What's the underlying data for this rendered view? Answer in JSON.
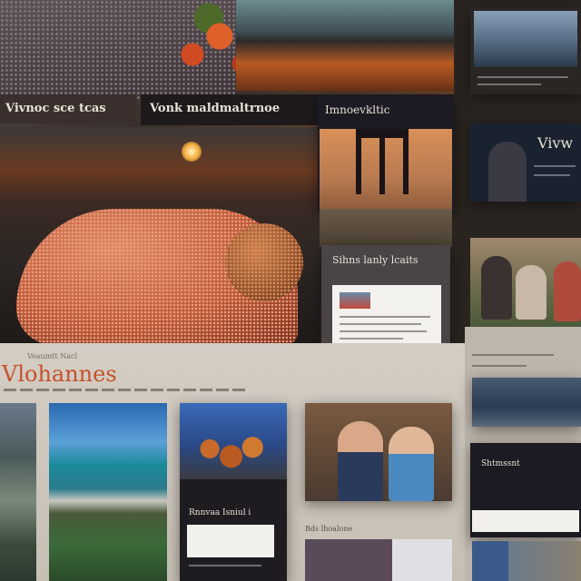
{
  "banner_top_left": "Vivnoc sce tcas",
  "banner_top_mid": "Vonk maldmaltrnoe",
  "card_right_top_title": "Imnoevkltic",
  "card_right_mid_title": "Sihns lanly lcaits",
  "thumb_right_text": "Vivw",
  "main_heading": "Vlohannes",
  "sub_heading_top": "Veaumtt Nacl",
  "card_bottom_title": "Rnnvaa Isniul i",
  "card_bottom_right_title": "Shtmssnt",
  "label_bottom_center": "Bds lhoalone",
  "colors": {
    "background": "#2a2420",
    "panel_dark": "#1c1a22",
    "panel_beige": "#cfc8bd",
    "accent_orange": "#c8502a",
    "sunset": "#e07a2c"
  }
}
